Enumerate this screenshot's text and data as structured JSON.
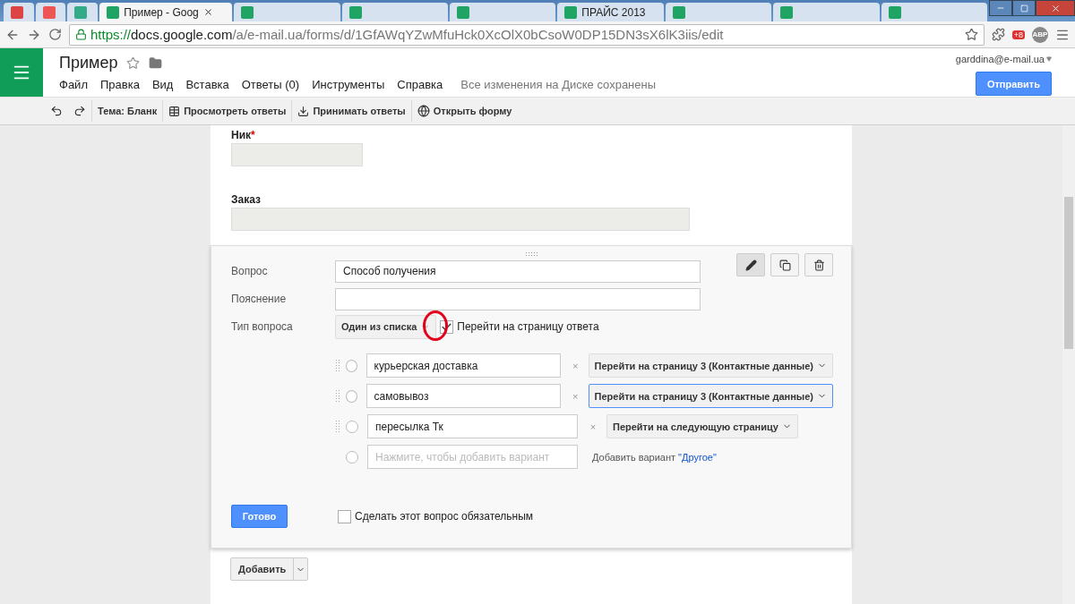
{
  "browser": {
    "tabs": [
      {
        "kind": "icon",
        "selected": false
      },
      {
        "kind": "icon",
        "selected": false
      },
      {
        "kind": "icon",
        "selected": false
      },
      {
        "kind": "text",
        "label": "Пример - Goog",
        "selected": true
      },
      {
        "kind": "text",
        "selected": false
      },
      {
        "kind": "text",
        "selected": false
      },
      {
        "kind": "text",
        "selected": false
      },
      {
        "kind": "text",
        "label": "ПРАЙС 2013",
        "selected": false
      },
      {
        "kind": "text",
        "selected": false
      },
      {
        "kind": "text",
        "selected": false
      },
      {
        "kind": "text",
        "selected": false
      }
    ],
    "url": {
      "scheme": "https://",
      "host": "docs.google.com",
      "path": "/a/e-mail.ua/forms/d/1GfAWqYZwMfuHck0XcOlX0bCsoW0DP15DN3sX6lK3iis/edit"
    },
    "extension_badge": "+8",
    "adblock_label": "ABP"
  },
  "header": {
    "title": "Пример",
    "menu": [
      "Файл",
      "Правка",
      "Вид",
      "Вставка",
      "Ответы (0)",
      "Инструменты",
      "Справка"
    ],
    "save_status": "Все изменения на Диске сохранены",
    "account": "garddina@e-mail.ua",
    "send_button": "Отправить"
  },
  "toolbar": [
    {
      "kind": "undo"
    },
    {
      "kind": "redo"
    },
    {
      "kind": "theme",
      "label": "Тема: Бланк"
    },
    {
      "kind": "view",
      "label": "Просмотреть ответы"
    },
    {
      "kind": "accept",
      "label": "Принимать ответы"
    },
    {
      "kind": "open",
      "label": "Открыть форму"
    }
  ],
  "fields": [
    {
      "label": "Ник",
      "required_mark": "*"
    },
    {
      "label": "Заказ"
    }
  ],
  "editor": {
    "question_label": "Вопрос",
    "question_value": "Способ получения",
    "hint_label": "Пояснение",
    "type_label": "Тип вопроса",
    "type_value": "Один из списка",
    "go_to_page": {
      "label": "Перейти на страницу ответа",
      "checked": true
    },
    "options": [
      {
        "value": "курьерская доставка",
        "target": "Перейти на страницу 3 (Контактные данные)",
        "focused": false,
        "selected": false
      },
      {
        "value": "самовывоз",
        "target": "Перейти на страницу 3 (Контактные данные)",
        "focused": true,
        "selected": false
      },
      {
        "value": "пересылка Тк",
        "target": "Перейти на следующую страницу",
        "focused": false,
        "selected": false
      }
    ],
    "remove_mark": "×",
    "new_option": {
      "placeholder": "Нажмите, чтобы добавить вариант",
      "selected": false
    },
    "add_other_text": "Добавить вариант",
    "add_other_link": "\"Другое\"",
    "done_button": "Готово",
    "required": {
      "label": "Сделать этот вопрос обязательным",
      "checked": false
    }
  },
  "add_button": "Добавить"
}
